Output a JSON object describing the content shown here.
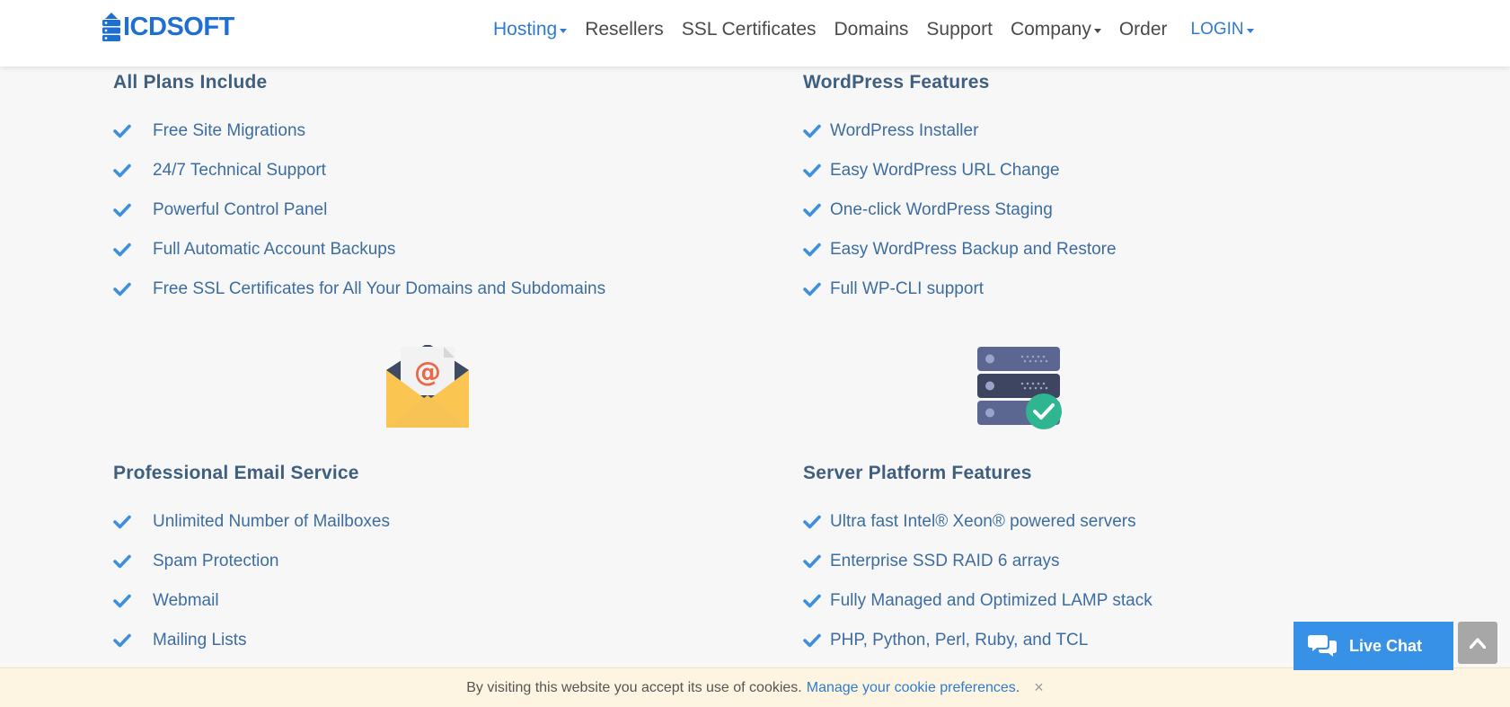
{
  "brand": {
    "name": "ICDSOFT",
    "color": "#1d6fd1"
  },
  "nav": {
    "items": [
      {
        "label": "Hosting",
        "dropdown": true,
        "active": true
      },
      {
        "label": "Resellers",
        "dropdown": false,
        "active": false
      },
      {
        "label": "SSL Certificates",
        "dropdown": false,
        "active": false
      },
      {
        "label": "Domains",
        "dropdown": false,
        "active": false
      },
      {
        "label": "Support",
        "dropdown": false,
        "active": false
      },
      {
        "label": "Company",
        "dropdown": true,
        "active": false
      },
      {
        "label": "Order",
        "dropdown": false,
        "active": false
      }
    ],
    "login": "LOGIN"
  },
  "sections": {
    "all_plans": {
      "title": "All Plans Include",
      "items": [
        "Free Site Migrations",
        "24/7 Technical Support",
        "Powerful Control Panel",
        "Full Automatic Account Backups",
        "Free SSL Certificates for All Your Domains and Subdomains"
      ]
    },
    "wordpress": {
      "title": "WordPress Features",
      "items": [
        "WordPress Installer",
        "Easy WordPress URL Change",
        "One-click WordPress Staging",
        "Easy WordPress Backup and Restore",
        "Full WP-CLI support"
      ]
    },
    "email": {
      "title": "Professional Email Service",
      "icon": "email-envelope-icon",
      "items": [
        "Unlimited Number of Mailboxes",
        "Spam Protection",
        "Webmail",
        "Mailing Lists"
      ]
    },
    "server": {
      "title": "Server Platform Features",
      "icon": "server-check-icon",
      "items": [
        "Ultra fast Intel® Xeon® powered servers",
        "Enterprise SSD RAID 6 arrays",
        "Fully Managed and Optimized LAMP stack",
        "PHP, Python, Perl, Ruby, and TCL"
      ]
    }
  },
  "live_chat": {
    "label": "Live Chat",
    "icon": "chat-bubbles-icon",
    "color": "#3791e6"
  },
  "scroll_top": {
    "icon": "chevron-up-icon"
  },
  "cookie": {
    "text": "By visiting this website you accept its use of cookies.",
    "link": "Manage your cookie preferences",
    "period": ".",
    "close": "×"
  },
  "colors": {
    "accent": "#2e7bd1",
    "check": "#3d8fe0",
    "heading": "#3f5f80",
    "feature_text": "#3d6da0"
  }
}
